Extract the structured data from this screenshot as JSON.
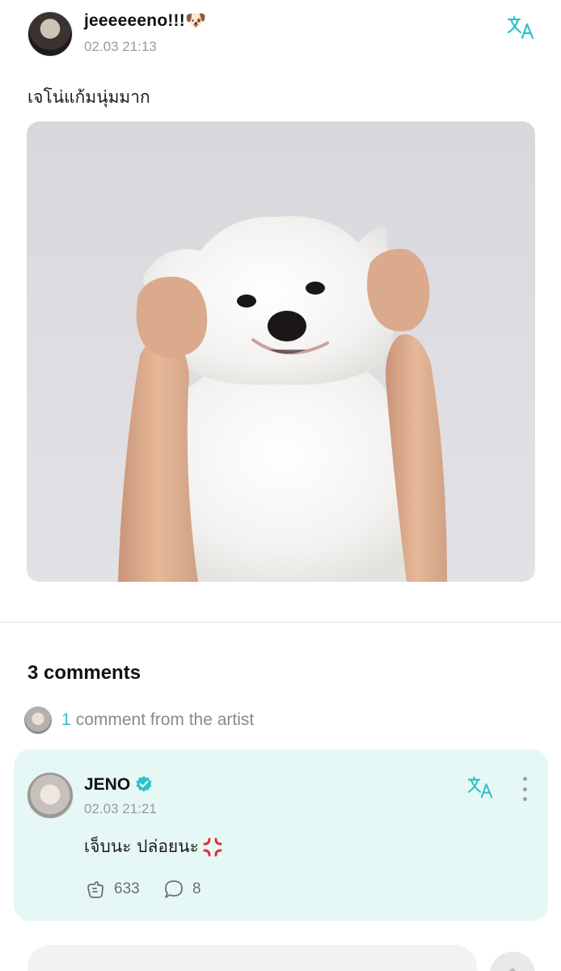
{
  "post": {
    "author": "jeeeeeeno!!!🐶",
    "time": "02.03 21:13",
    "text": "เจโน่แก้มนุ่มมาก"
  },
  "comments_section": {
    "count_label": "3 comments",
    "artist_count": "1",
    "artist_label": "comment from the artist"
  },
  "artist_comment": {
    "author": "JENO",
    "time": "02.03 21:21",
    "text": "เจ็บนะ ปล่อยนะ",
    "likes": "633",
    "replies": "8"
  },
  "colors": {
    "accent": "#2fc0c9",
    "comment_bg": "#e6f8f5",
    "verified": "#2fc0c9"
  },
  "icons": [
    "translate-icon",
    "verified-badge-icon",
    "more-icon",
    "anger-icon",
    "like-icon",
    "reply-icon",
    "send-icon"
  ]
}
